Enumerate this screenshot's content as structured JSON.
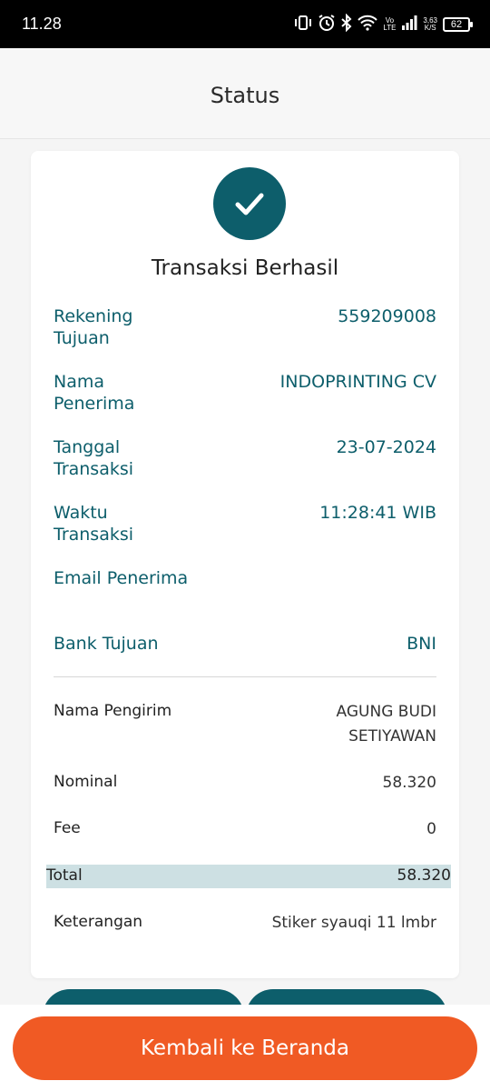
{
  "status_bar": {
    "time": "11.28",
    "network_line1": "Vo",
    "network_line2": "LTE",
    "speed_value": "3,63",
    "speed_unit": "K/S",
    "battery": "62"
  },
  "header": {
    "title": "Status"
  },
  "result": {
    "title": "Transaksi Berhasil",
    "icon": "check-circle-icon",
    "icon_color": "#0d5e6b"
  },
  "recipient": [
    {
      "label": "Rekening Tujuan",
      "value": "559209008"
    },
    {
      "label": "Nama Penerima",
      "value": "INDOPRINTING CV"
    },
    {
      "label": "Tanggal Transaksi",
      "value": "23-07-2024"
    },
    {
      "label": "Waktu Transaksi",
      "value": "11:28:41 WIB"
    },
    {
      "label": "Email Penerima",
      "value": ""
    },
    {
      "label": "Bank Tujuan",
      "value": "BNI"
    }
  ],
  "details": {
    "sender_label": "Nama Pengirim",
    "sender_value": "AGUNG BUDI SETIYAWAN",
    "nominal_label": "Nominal",
    "nominal_value": "58.320",
    "fee_label": "Fee",
    "fee_value": "0",
    "total_label": "Total",
    "total_value": "58.320",
    "note_label": "Keterangan",
    "note_value": "Stiker syauqi 11 lmbr"
  },
  "actions": {
    "back_label": "Kembali ke Beranda"
  },
  "colors": {
    "accent": "#0d5e6b",
    "cta": "#f05a24",
    "total_highlight": "#cde0e3"
  }
}
